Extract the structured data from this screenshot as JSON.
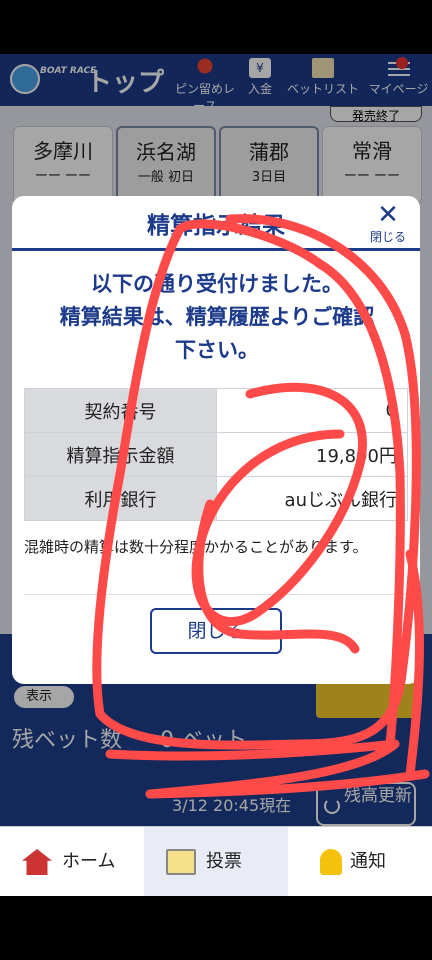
{
  "header": {
    "logo_text": "BOAT RACE",
    "title": "トップ",
    "nav": {
      "pin": "ピン留めレース",
      "deposit": "入金",
      "deposit_icon_glyph": "¥",
      "betlist": "ベットリスト",
      "mypage": "マイページ"
    }
  },
  "venues": [
    {
      "name": "多摩川",
      "status": "ーー\nーー"
    },
    {
      "name": "浜名湖",
      "status": "一般 初日"
    },
    {
      "name": "蒲郡",
      "status": "3日目"
    },
    {
      "name": "常滑",
      "status": "ーー\nーー"
    }
  ],
  "finished_tag": "発売終了",
  "modal": {
    "title": "精算指示結果",
    "close_icon_label": "閉じる",
    "message_line1": "以下の通り受付けました。",
    "message_line2": "精算結果は、精算履歴よりご確認",
    "message_line3": "下さい。",
    "table": [
      {
        "label": "契約番号",
        "value": "0"
      },
      {
        "label": "精算指示金額",
        "value": "19,890円"
      },
      {
        "label": "利用銀行",
        "value": "auじぶん銀行"
      }
    ],
    "note": "混雑時の精算は数十分程度かかることがあります。",
    "close_button": "閉じる"
  },
  "balance": {
    "toggle_label": "表示",
    "remaining_label": "残ベット数",
    "remaining_value": "0 ベット",
    "updated_at": "3/12 20:45現在",
    "refresh_label": "残高更新"
  },
  "bottom_nav": {
    "home": "ホーム",
    "vote": "投票",
    "notify": "通知"
  },
  "colors": {
    "brand_blue": "#1c3b8a",
    "scribble_red": "#ff4a4a",
    "deposit_yellow": "#f3c92b"
  }
}
